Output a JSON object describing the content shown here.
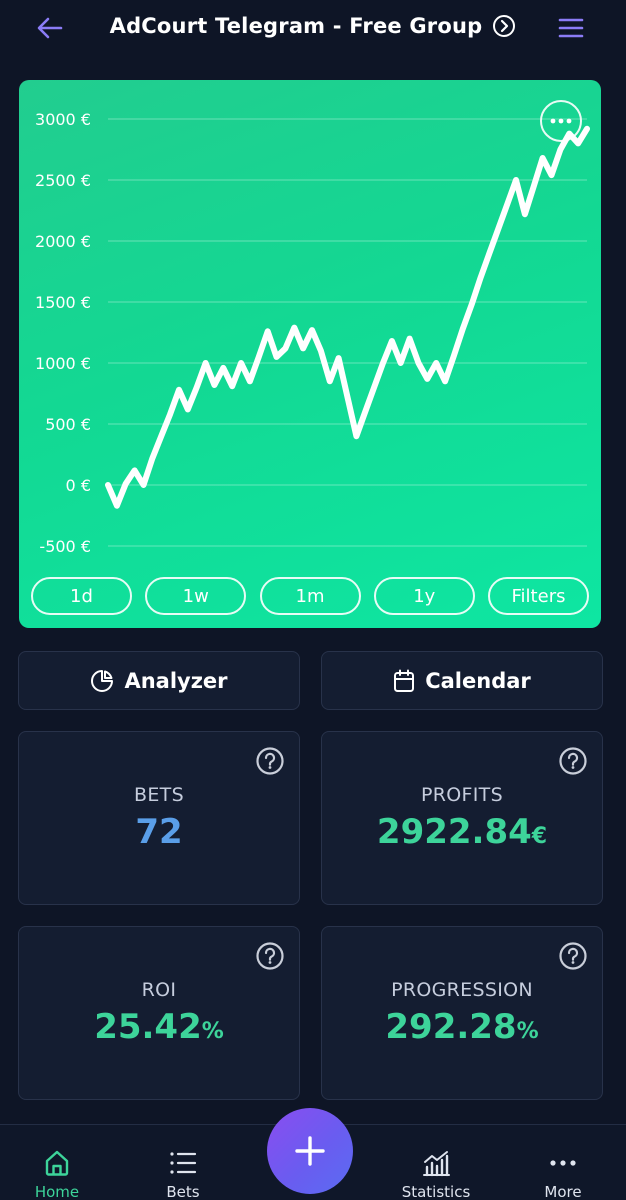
{
  "header": {
    "title": "AdCourt Telegram - Free Group",
    "back_icon": "arrow-left-icon",
    "menu_icon": "hamburger-menu-icon",
    "accent_color": "#8b7cf6"
  },
  "chart_data": {
    "type": "line",
    "y_ticks": [
      "3000 €",
      "2500 €",
      "2000 €",
      "1500 €",
      "1000 €",
      "500 €",
      "0 €",
      "-500 €"
    ],
    "ylim": [
      -500,
      3000
    ],
    "grid": true,
    "line_color": "#ffffff",
    "series": [
      {
        "values": [
          0,
          -170,
          10,
          120,
          0,
          220,
          400,
          580,
          780,
          620,
          800,
          1000,
          820,
          960,
          810,
          1000,
          850,
          1050,
          1260,
          1050,
          1120,
          1290,
          1120,
          1270,
          1100,
          850,
          1040,
          720,
          400,
          600,
          800,
          1000,
          1180,
          1000,
          1200,
          1000,
          870,
          1000,
          850,
          1060,
          1280,
          1480,
          1700,
          1900,
          2100,
          2300,
          2500,
          2220,
          2450,
          2680,
          2540,
          2750,
          2880,
          2800,
          2920
        ]
      }
    ]
  },
  "range_buttons": [
    "1d",
    "1w",
    "1m",
    "1y",
    "Filters"
  ],
  "actions": {
    "analyzer": "Analyzer",
    "calendar": "Calendar"
  },
  "stats": {
    "bets": {
      "label": "BETS",
      "value": "72"
    },
    "profits": {
      "label": "PROFITS",
      "value": "2922.84",
      "unit": "€"
    },
    "roi": {
      "label": "ROI",
      "value": "25.42",
      "unit": "%"
    },
    "progression": {
      "label": "PROGRESSION",
      "value": "292.28",
      "unit": "%"
    }
  },
  "nav": {
    "home": "Home",
    "bets": "Bets",
    "statistics": "Statistics",
    "more": "More",
    "active_color": "#3dd49a"
  }
}
